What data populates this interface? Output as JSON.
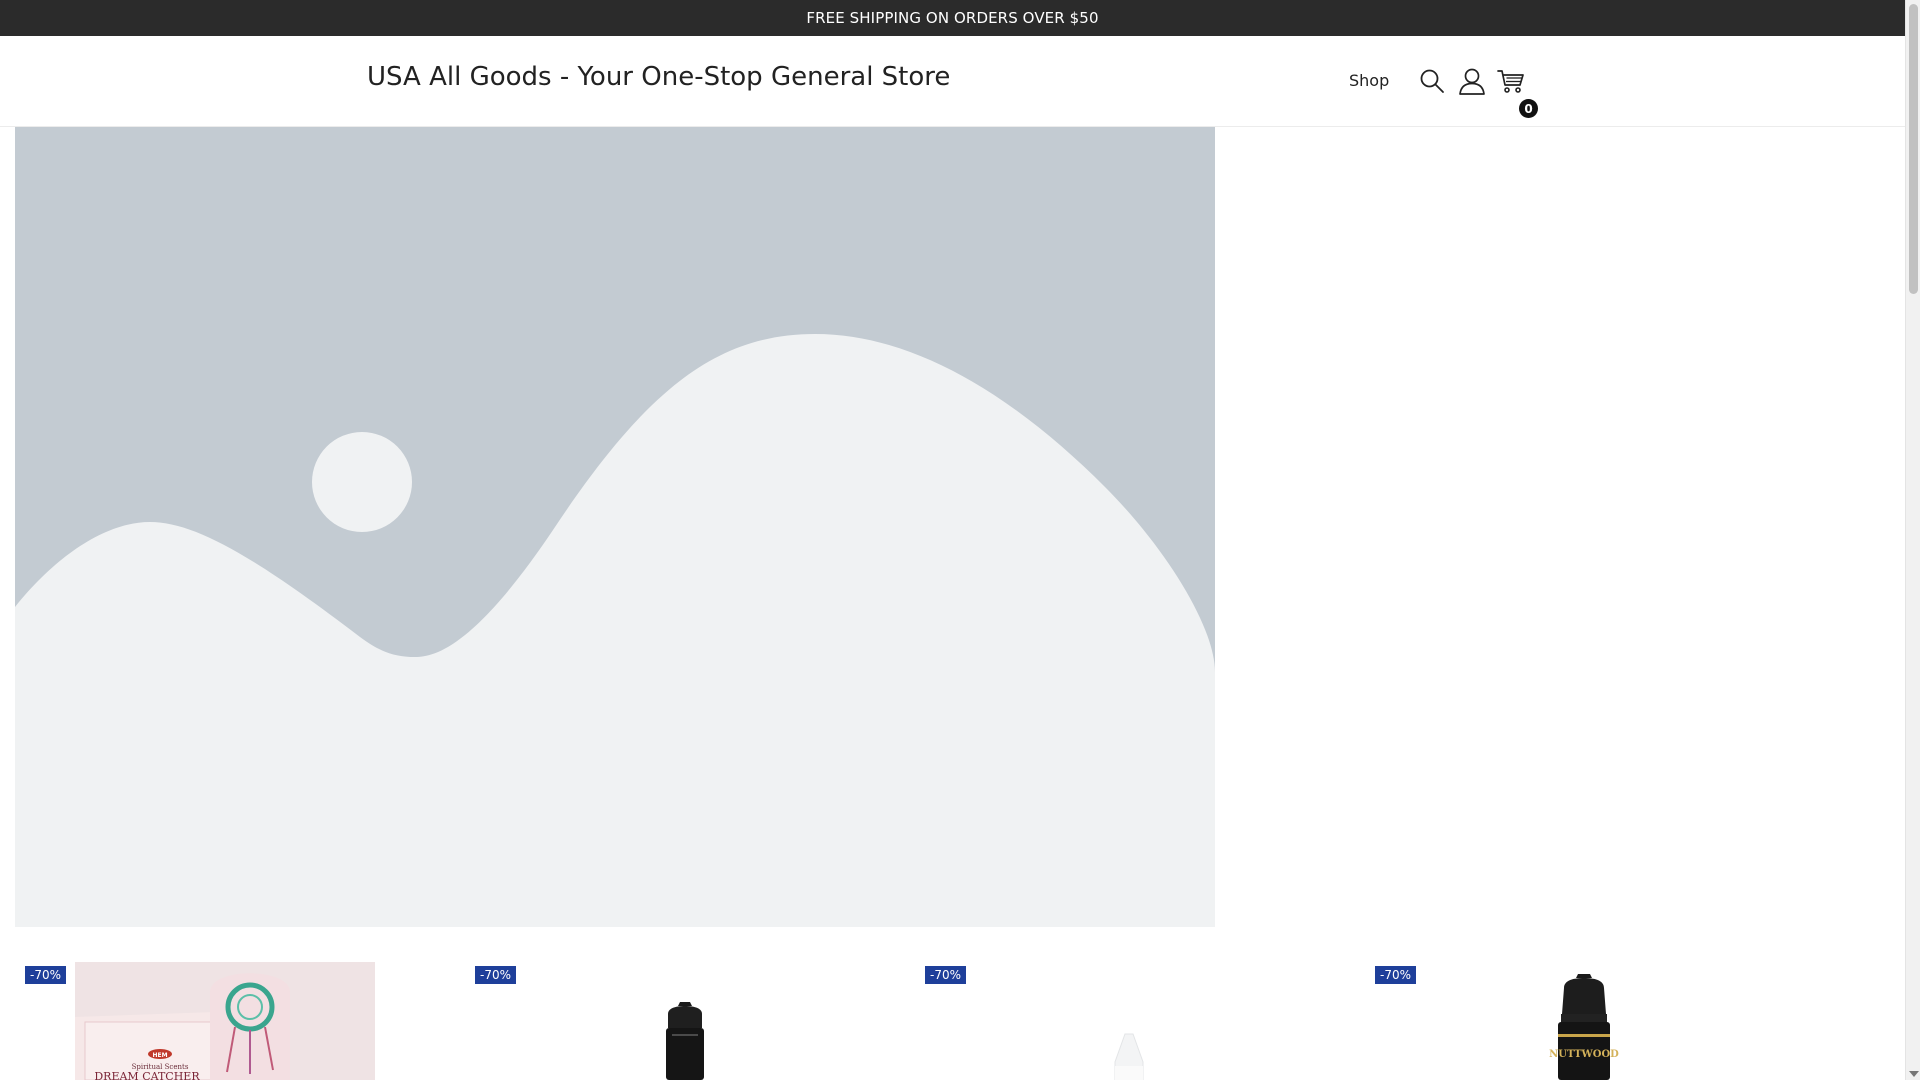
{
  "announcement": {
    "text": "FREE SHIPPING ON ORDERS OVER $50"
  },
  "header": {
    "site_title": "USA All Goods - Your One-Stop General Store",
    "nav": {
      "shop_label": "Shop"
    },
    "icons": {
      "search": "search-icon",
      "account": "user-icon",
      "cart": "cart-icon"
    },
    "cart_count": "0"
  },
  "hero": {
    "image": "image-placeholder"
  },
  "products": [
    {
      "badge": "-70%",
      "image": "dream-catcher-incense-box",
      "label_top": "HEM",
      "label_sub": "Spiritual Scents",
      "label_name": "DREAM CATCHER"
    },
    {
      "badge": "-70%",
      "image": "black-eliquid-bottle"
    },
    {
      "badge": "-70%",
      "image": "clear-eliquid-bottle"
    },
    {
      "badge": "-70%",
      "image": "black-gold-eliquid-bottle",
      "label_name": "NUTTWOOD"
    }
  ],
  "colors": {
    "announcement_bg": "#2b2b2b",
    "badge_bg": "#1e3f9a",
    "hero_bg": "#c3cbd2",
    "hero_fg": "#f0f2f3"
  }
}
